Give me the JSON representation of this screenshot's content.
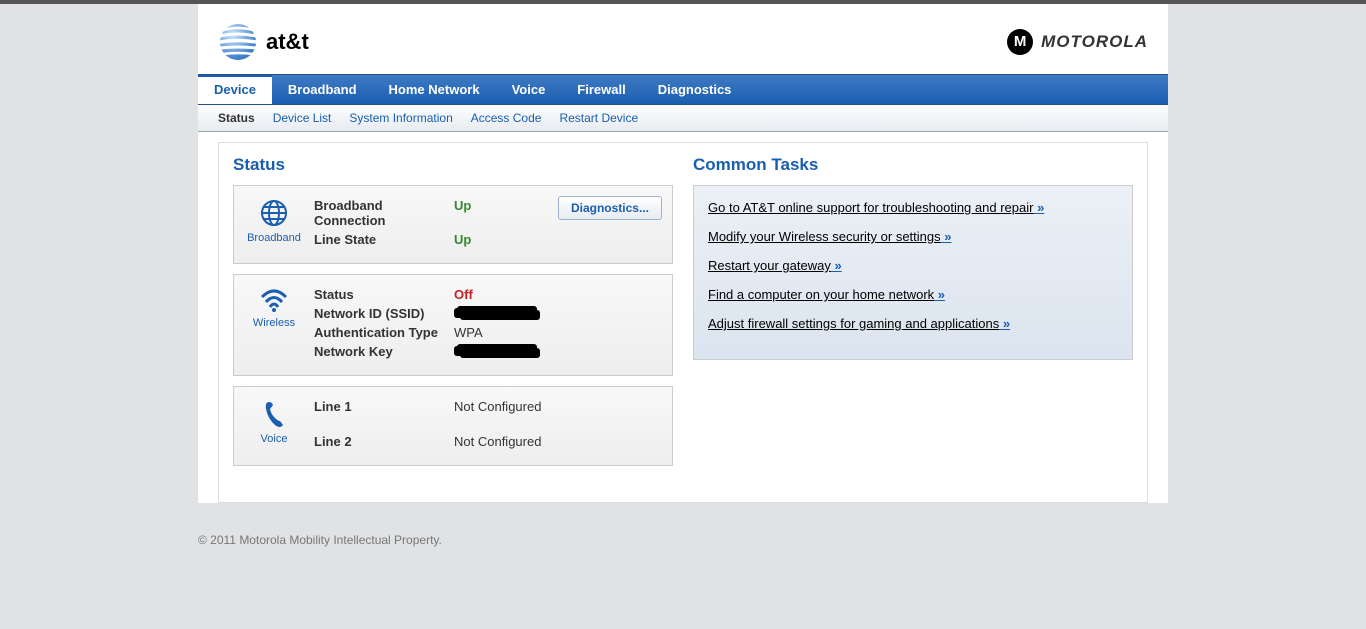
{
  "brand": {
    "att": "at&t",
    "motorola": "MOTOROLA"
  },
  "nav": {
    "primary": [
      "Device",
      "Broadband",
      "Home Network",
      "Voice",
      "Firewall",
      "Diagnostics"
    ],
    "active_primary": "Device",
    "secondary": [
      "Status",
      "Device List",
      "System Information",
      "Access Code",
      "Restart Device"
    ],
    "active_secondary": "Status"
  },
  "status": {
    "title": "Status",
    "diagnostics_btn": "Diagnostics...",
    "broadband": {
      "label": "Broadband",
      "rows": [
        {
          "lbl": "Broadband Connection",
          "val": "Up",
          "cls": "val-up"
        },
        {
          "lbl": "Line State",
          "val": "Up",
          "cls": "val-up"
        }
      ]
    },
    "wireless": {
      "label": "Wireless",
      "rows": [
        {
          "lbl": "Status",
          "val": "Off",
          "cls": "val-off"
        },
        {
          "lbl": "Network ID (SSID)",
          "val": "[redacted]",
          "cls": "redacted"
        },
        {
          "lbl": "Authentication Type",
          "val": "WPA",
          "cls": ""
        },
        {
          "lbl": "Network Key",
          "val": "[redacted]",
          "cls": "redacted"
        }
      ]
    },
    "voice": {
      "label": "Voice",
      "rows": [
        {
          "lbl": "Line 1",
          "val": "Not Configured",
          "cls": ""
        },
        {
          "lbl": "Line 2",
          "val": "Not Configured",
          "cls": ""
        }
      ]
    }
  },
  "tasks": {
    "title": "Common Tasks",
    "items": [
      "Go to AT&T online support for troubleshooting and repair",
      "Modify your Wireless security or settings",
      "Restart your gateway",
      "Find a computer on your home network",
      "Adjust firewall settings for gaming and applications"
    ]
  },
  "footer": "© 2011 Motorola Mobility Intellectual Property."
}
